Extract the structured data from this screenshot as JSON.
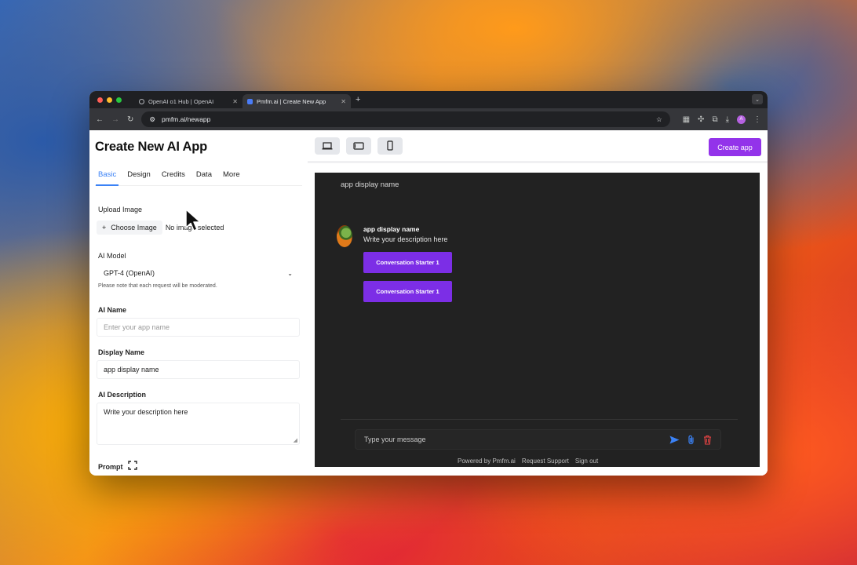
{
  "browser": {
    "tabs": [
      {
        "title": "OpenAI o1 Hub | OpenAI",
        "active": false
      },
      {
        "title": "Pmfm.ai | Create New App",
        "active": true
      }
    ],
    "new_tab": "+",
    "url": "pmfm.ai/newapp",
    "profile_initial": "A"
  },
  "left": {
    "title": "Create New AI App",
    "tabs": [
      "Basic",
      "Design",
      "Credits",
      "Data",
      "More"
    ],
    "upload": {
      "label": "Upload Image",
      "button": "Choose Image",
      "status": "No image selected"
    },
    "model": {
      "label": "AI Model",
      "selected": "GPT-4 (OpenAI)",
      "note": "Please note that each request will be moderated."
    },
    "ai_name": {
      "label": "AI Name",
      "placeholder": "Enter your app name",
      "value": ""
    },
    "display_name": {
      "label": "Display Name",
      "value": "app display name"
    },
    "description": {
      "label": "AI Description",
      "value": "Write your description here"
    },
    "prompt": {
      "label": "Prompt"
    }
  },
  "right": {
    "create_button": "Create app",
    "preview": {
      "header": "app display name",
      "bot_name": "app display name",
      "bot_description": "Write your description here",
      "starters": [
        "Conversation Starter 1",
        "Conversation Starter 1"
      ],
      "input_placeholder": "Type your message",
      "footer": [
        "Powered by Pmfm.ai",
        "Request Support",
        "Sign out"
      ]
    }
  },
  "colors": {
    "accent": "#9333ea",
    "starter": "#7c2ee6",
    "tab_active": "#3b82f6",
    "send": "#3b82f6",
    "trash": "#ef4444"
  }
}
